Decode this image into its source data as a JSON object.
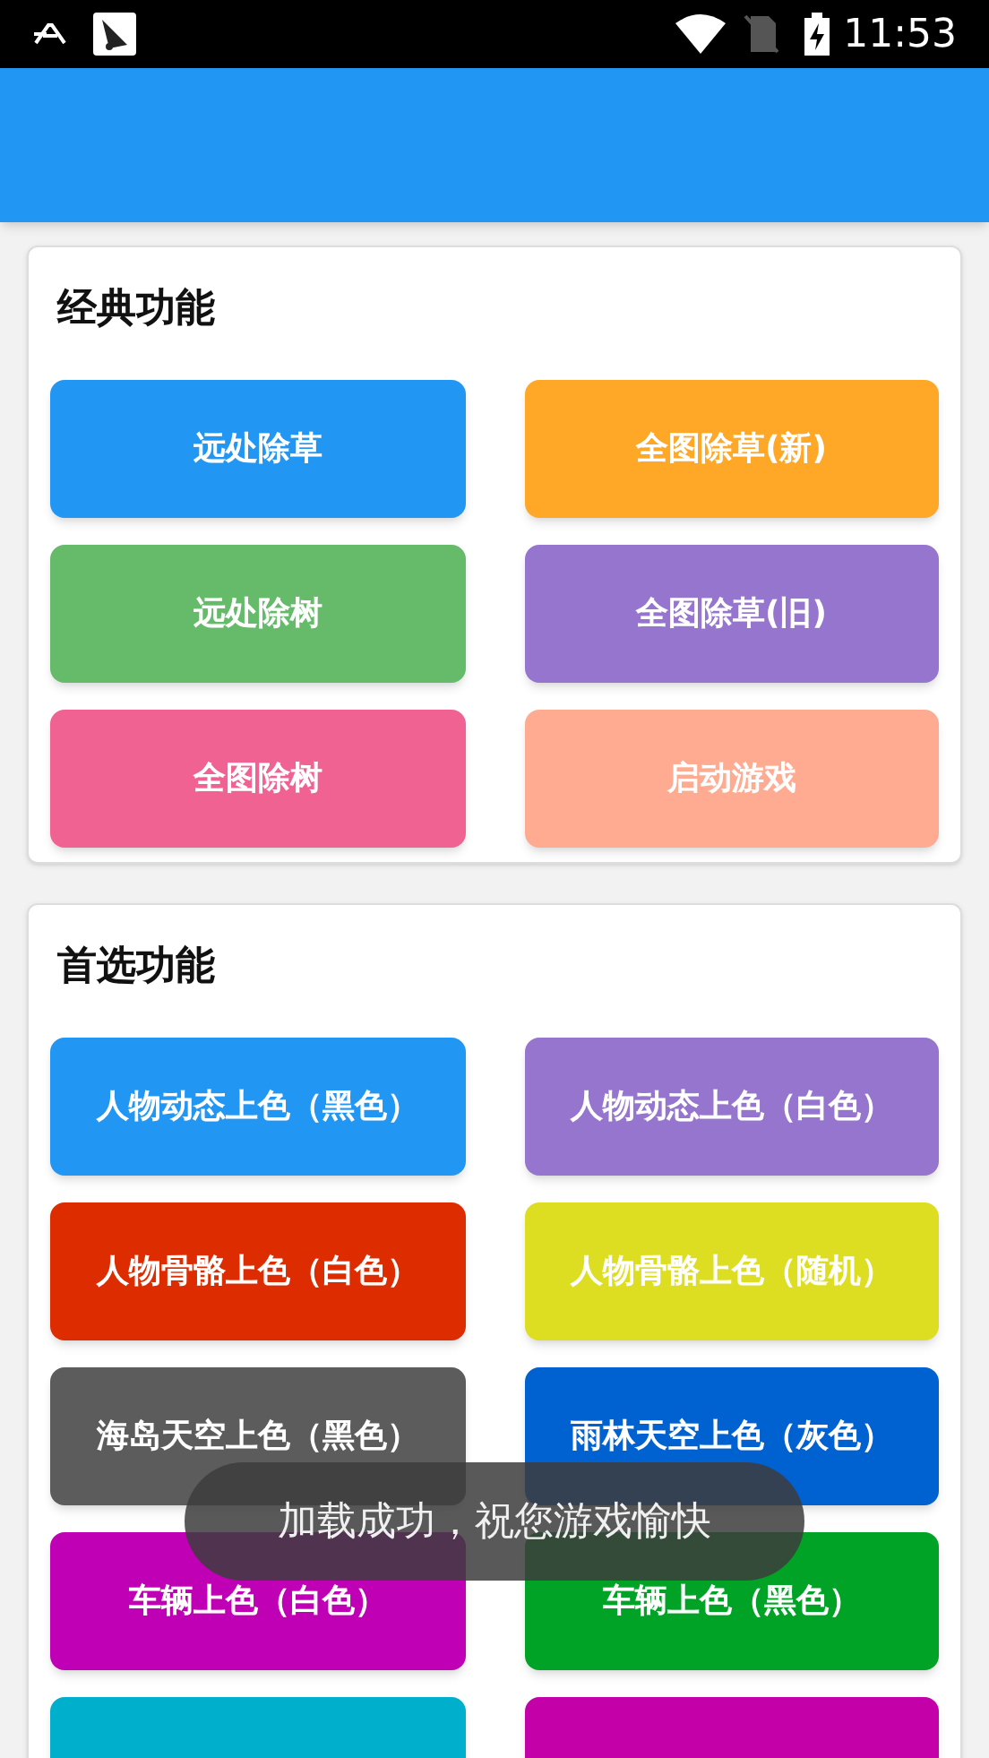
{
  "status_bar": {
    "time": "11:53"
  },
  "sections": [
    {
      "title": "经典功能",
      "buttons": [
        {
          "label": "远处除草",
          "color": "#2196f3"
        },
        {
          "label": "全图除草(新)",
          "color": "#ffa726"
        },
        {
          "label": "远处除树",
          "color": "#66bb6a"
        },
        {
          "label": "全图除草(旧)",
          "color": "#9575cd"
        },
        {
          "label": "全图除树",
          "color": "#f06292"
        },
        {
          "label": "启动游戏",
          "color": "#ffab91"
        }
      ]
    },
    {
      "title": "首选功能",
      "buttons": [
        {
          "label": "人物动态上色（黑色）",
          "color": "#2196f3"
        },
        {
          "label": "人物动态上色（白色）",
          "color": "#9575cd"
        },
        {
          "label": "人物骨骼上色（白色）",
          "color": "#dd2c00"
        },
        {
          "label": "人物骨骼上色（随机）",
          "color": "#dddd22"
        },
        {
          "label": "海岛天空上色（黑色）",
          "color": "#5c5c5c"
        },
        {
          "label": "雨林天空上色（灰色）",
          "color": "#0061d1"
        },
        {
          "label": "车辆上色（白色）",
          "color": "#c000b5"
        },
        {
          "label": "车辆上色（黑色）",
          "color": "#00a325"
        },
        {
          "color": "#00afcc"
        },
        {
          "color": "#c400a8"
        }
      ]
    }
  ],
  "toast": "加载成功，祝您游戏愉快"
}
